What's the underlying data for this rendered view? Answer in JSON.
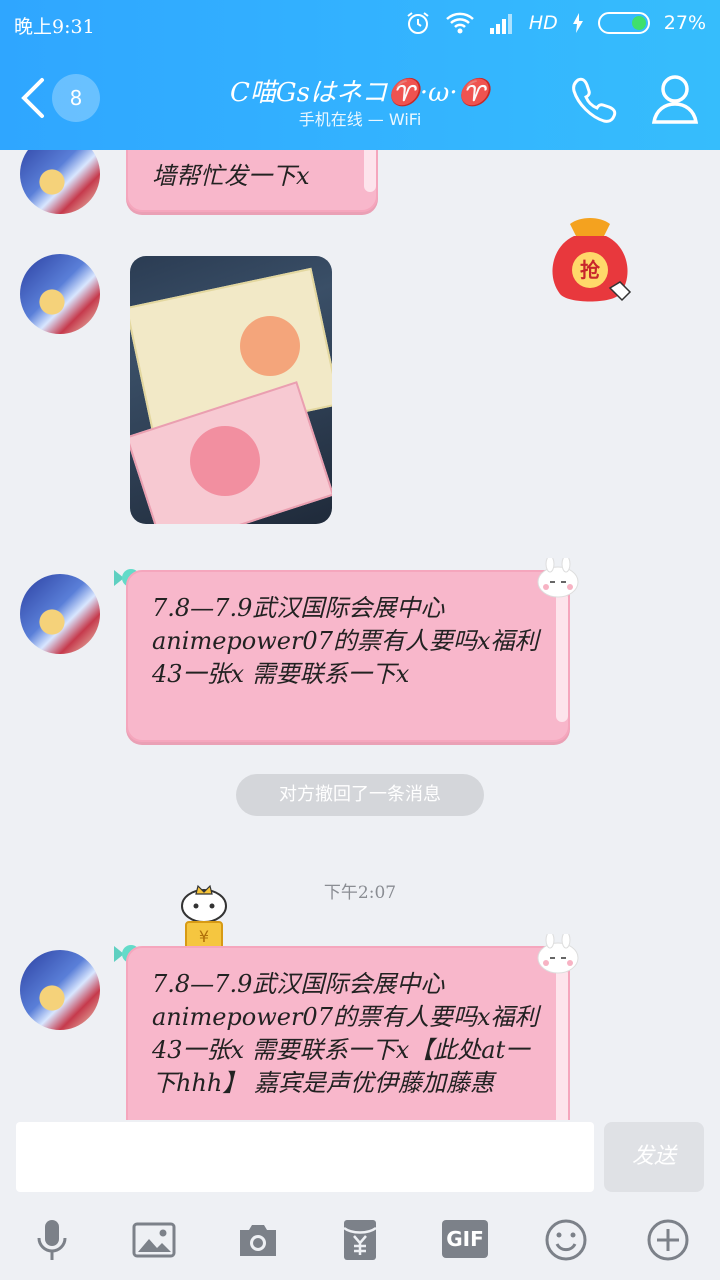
{
  "status_bar": {
    "time": "晚上9:31",
    "network": "HD",
    "battery": "27%"
  },
  "header": {
    "unread_count": "8",
    "title": "C喵Gsはネコ♈·ω·♈",
    "subtitle": "手机在线 — WiFi"
  },
  "messages": [
    {
      "type": "text",
      "text": "墙帮忙发一下x"
    },
    {
      "type": "image",
      "description_icon": "photo-thumbnail"
    },
    {
      "type": "text",
      "text": "7.8—7.9武汉国际会展中心animepower07的票有人要吗x福利43一张x 需要联系一下x"
    },
    {
      "type": "system",
      "text": "对方撤回了一条消息"
    },
    {
      "type": "timestamp",
      "text": "下午2:07"
    },
    {
      "type": "text",
      "text": "7.8—7.9武汉国际会展中心animepower07的票有人要吗x福利43一张x 需要联系一下x【此处at一下hhh】 嘉宾是声优伊藤加藤惠"
    }
  ],
  "red_packet": {
    "label": "抢"
  },
  "mascot": {
    "label": "¥"
  },
  "input": {
    "value": "",
    "send_label": "发送"
  },
  "toolbar": {
    "gif_label": "GIF"
  },
  "colors": {
    "header": "#33b2ff",
    "bubble": "#f8b7cb",
    "background": "#eef0f4"
  }
}
